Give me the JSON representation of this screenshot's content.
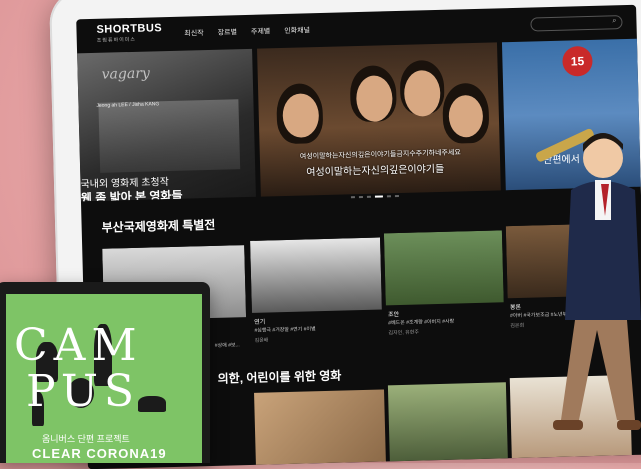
{
  "header": {
    "brand": "SHORTBUS",
    "brand_sub": "조림퓨바이미스",
    "nav": [
      "최신작",
      "장르별",
      "주제별",
      "인화채널"
    ]
  },
  "hero": {
    "left": {
      "script_title": "vagary",
      "credit": "Jeong ah LEE / Jisha KANG",
      "caption_line1": "국내외 영화제 초청작",
      "caption_line2": "웬 좀 밟아 본 영화들"
    },
    "center": {
      "subtitle_small": "여성이말하는자신의깊은이야기들금지수주기하네주세요",
      "subtitle_large": "여성이말하는자신의깊은이야기들"
    },
    "right": {
      "badge": "15",
      "caption": "단편에서"
    }
  },
  "section1": {
    "title": "부산국제영화제 특별전",
    "cards": [
      {
        "title": "",
        "tags": "#상애 #보..."
      },
      {
        "title": "연기",
        "tags": "#심행극 #거장알 #연기 #이별",
        "director": "김윤배"
      },
      {
        "title": "조안",
        "tags": "#베드온 #조계량 #아버지 #사랑",
        "director": "김자인, 유현주"
      },
      {
        "title": "봉론",
        "tags": "#아버 #국가보조금 #노년부 #현실 #조부",
        "director": "김은희"
      }
    ]
  },
  "section2": {
    "title": "의한, 어린이를 위한 영화"
  },
  "laptop": {
    "campus_line1": "CAM",
    "campus_line2": "PUS",
    "subtitle": "옴니버스 단편 프로젝트",
    "title": "CLEAR CORONA19"
  }
}
